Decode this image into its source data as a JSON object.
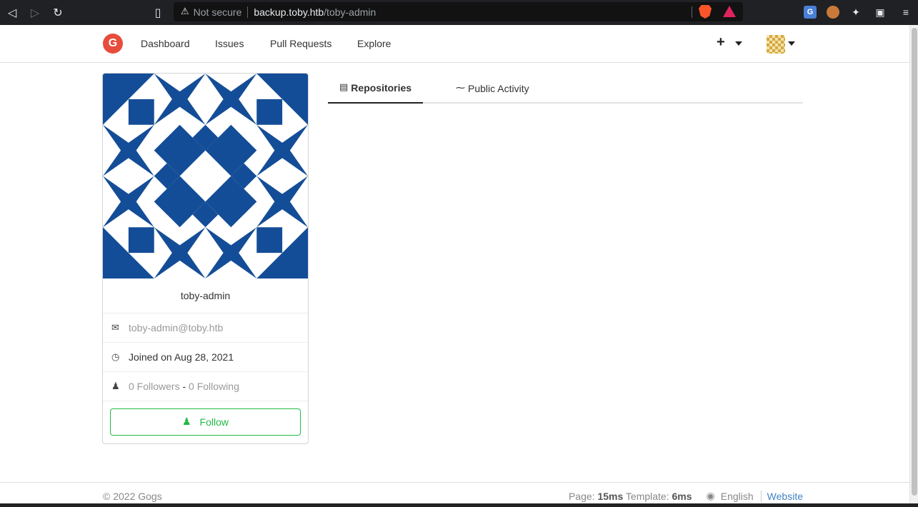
{
  "browser": {
    "not_secure": "Not secure",
    "url_host": "backup.toby.htb",
    "url_path": "/toby-admin"
  },
  "header": {
    "nav": [
      "Dashboard",
      "Issues",
      "Pull Requests",
      "Explore"
    ],
    "plus_label": "+"
  },
  "profile": {
    "username": "toby-admin",
    "email": "toby-admin@toby.htb",
    "joined": "Joined on Aug 28, 2021",
    "followers": "0 Followers",
    "separator": " - ",
    "following": "0 Following",
    "follow_label": "Follow",
    "avatar_color": "#144d97"
  },
  "tabs": [
    {
      "label": "Repositories",
      "active": true
    },
    {
      "label": "Public Activity",
      "active": false
    }
  ],
  "footer": {
    "copyright": "© 2022 Gogs",
    "page_label": "Page: ",
    "page_time": "15ms",
    "template_label": " Template: ",
    "template_time": "6ms",
    "language": "English",
    "website": "Website"
  }
}
